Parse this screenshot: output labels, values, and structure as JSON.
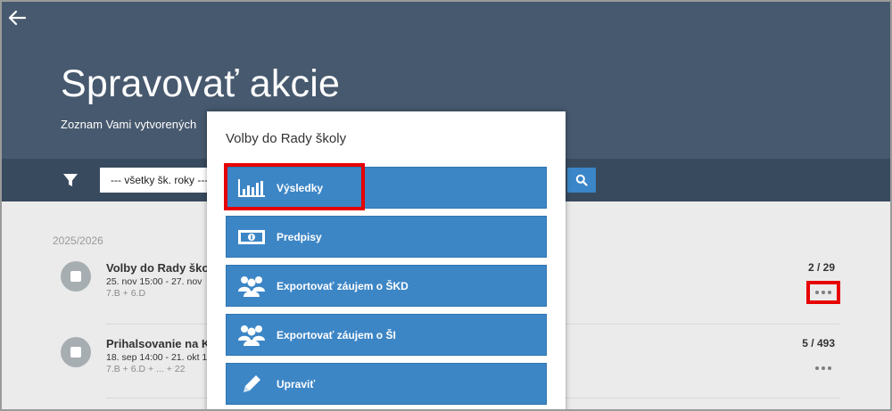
{
  "header": {
    "title": "Spravovať akcie",
    "subtitle": "Zoznam Vami vytvorených"
  },
  "filter": {
    "year_select_value": "--- všetky šk. roky ---"
  },
  "list": {
    "year_heading": "2025/2026",
    "events": [
      {
        "name": "Volby do Rady ško",
        "date": "25. nov 15:00 - 27. nov",
        "classes": "7.B + 6.D",
        "count": "2 / 29"
      },
      {
        "name": "Prihalsovanie na K",
        "date": "18. sep 14:00 - 21. okt 1",
        "classes": "7.B + 6.D + ... + 22",
        "count": "5 / 493"
      }
    ]
  },
  "popup": {
    "title": "Volby do Rady školy",
    "items": [
      {
        "label": "Výsledky",
        "icon": "bar-chart-icon"
      },
      {
        "label": "Predpisy",
        "icon": "banknote-icon"
      },
      {
        "label": "Exportovať záujem o ŠKD",
        "icon": "users-icon"
      },
      {
        "label": "Exportovať záujem o ŠI",
        "icon": "users-icon"
      },
      {
        "label": "Upraviť",
        "icon": "pencil-icon"
      }
    ]
  },
  "colors": {
    "header_bg": "#47596e",
    "filterbar_bg": "#384a5e",
    "button_blue": "#3d86c6",
    "highlight_red": "#e60000"
  }
}
